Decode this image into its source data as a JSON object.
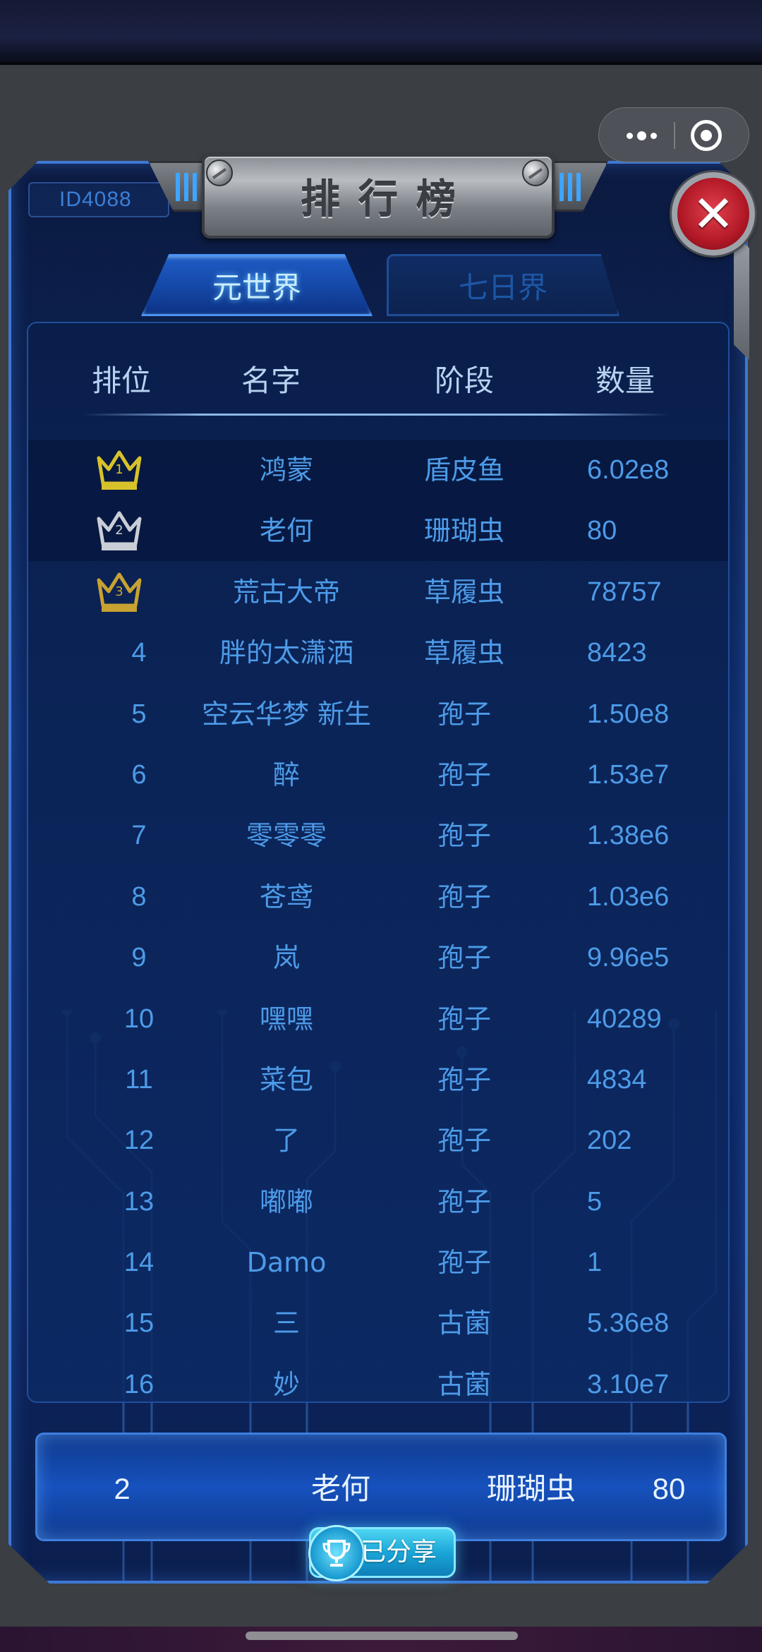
{
  "title": "排行榜",
  "player_id": "ID4088",
  "tabs": [
    {
      "label": "元世界",
      "active": true
    },
    {
      "label": "七日界",
      "active": false
    }
  ],
  "columns": {
    "rank": "排位",
    "name": "名字",
    "stage": "阶段",
    "quantity": "数量"
  },
  "rows": [
    {
      "rank": "1",
      "crown": "gold",
      "name": "鸿蒙",
      "stage": "盾皮鱼",
      "quantity": "6.02e8"
    },
    {
      "rank": "2",
      "crown": "silver",
      "name": "老何",
      "stage": "珊瑚虫",
      "quantity": "80"
    },
    {
      "rank": "3",
      "crown": "bronze",
      "name": "荒古大帝",
      "stage": "草履虫",
      "quantity": "78757"
    },
    {
      "rank": "4",
      "name": "胖的太潇洒",
      "stage": "草履虫",
      "quantity": "8423"
    },
    {
      "rank": "5",
      "name": "空云华梦 新生",
      "stage": "孢子",
      "quantity": "1.50e8"
    },
    {
      "rank": "6",
      "name": "醉",
      "stage": "孢子",
      "quantity": "1.53e7"
    },
    {
      "rank": "7",
      "name": "零零零",
      "stage": "孢子",
      "quantity": "1.38e6"
    },
    {
      "rank": "8",
      "name": "苍鸢",
      "stage": "孢子",
      "quantity": "1.03e6"
    },
    {
      "rank": "9",
      "name": "岚",
      "stage": "孢子",
      "quantity": "9.96e5"
    },
    {
      "rank": "10",
      "name": "嘿嘿",
      "stage": "孢子",
      "quantity": "40289"
    },
    {
      "rank": "11",
      "name": "菜包",
      "stage": "孢子",
      "quantity": "4834"
    },
    {
      "rank": "12",
      "name": "了",
      "stage": "孢子",
      "quantity": "202"
    },
    {
      "rank": "13",
      "name": "嘟嘟",
      "stage": "孢子",
      "quantity": "5"
    },
    {
      "rank": "14",
      "name": "Damo",
      "stage": "孢子",
      "quantity": "1"
    },
    {
      "rank": "15",
      "name": "三",
      "stage": "古菌",
      "quantity": "5.36e8"
    },
    {
      "rank": "16",
      "name": "妙",
      "stage": "古菌",
      "quantity": "3.10e7"
    }
  ],
  "my_entry": {
    "rank": "2",
    "name": "老何",
    "stage": "珊瑚虫",
    "quantity": "80"
  },
  "share": {
    "label": "已分享",
    "icon": "trophy-icon"
  },
  "icons": {
    "close": "close-x-icon",
    "capsule_more": "more-dots-icon",
    "capsule_exit": "target-icon"
  },
  "colors": {
    "gold": "#d8c22a",
    "silver": "#c9ced6",
    "bronze": "#c7a232",
    "accent": "#4d9be8",
    "close_red": "#c91f2e"
  }
}
